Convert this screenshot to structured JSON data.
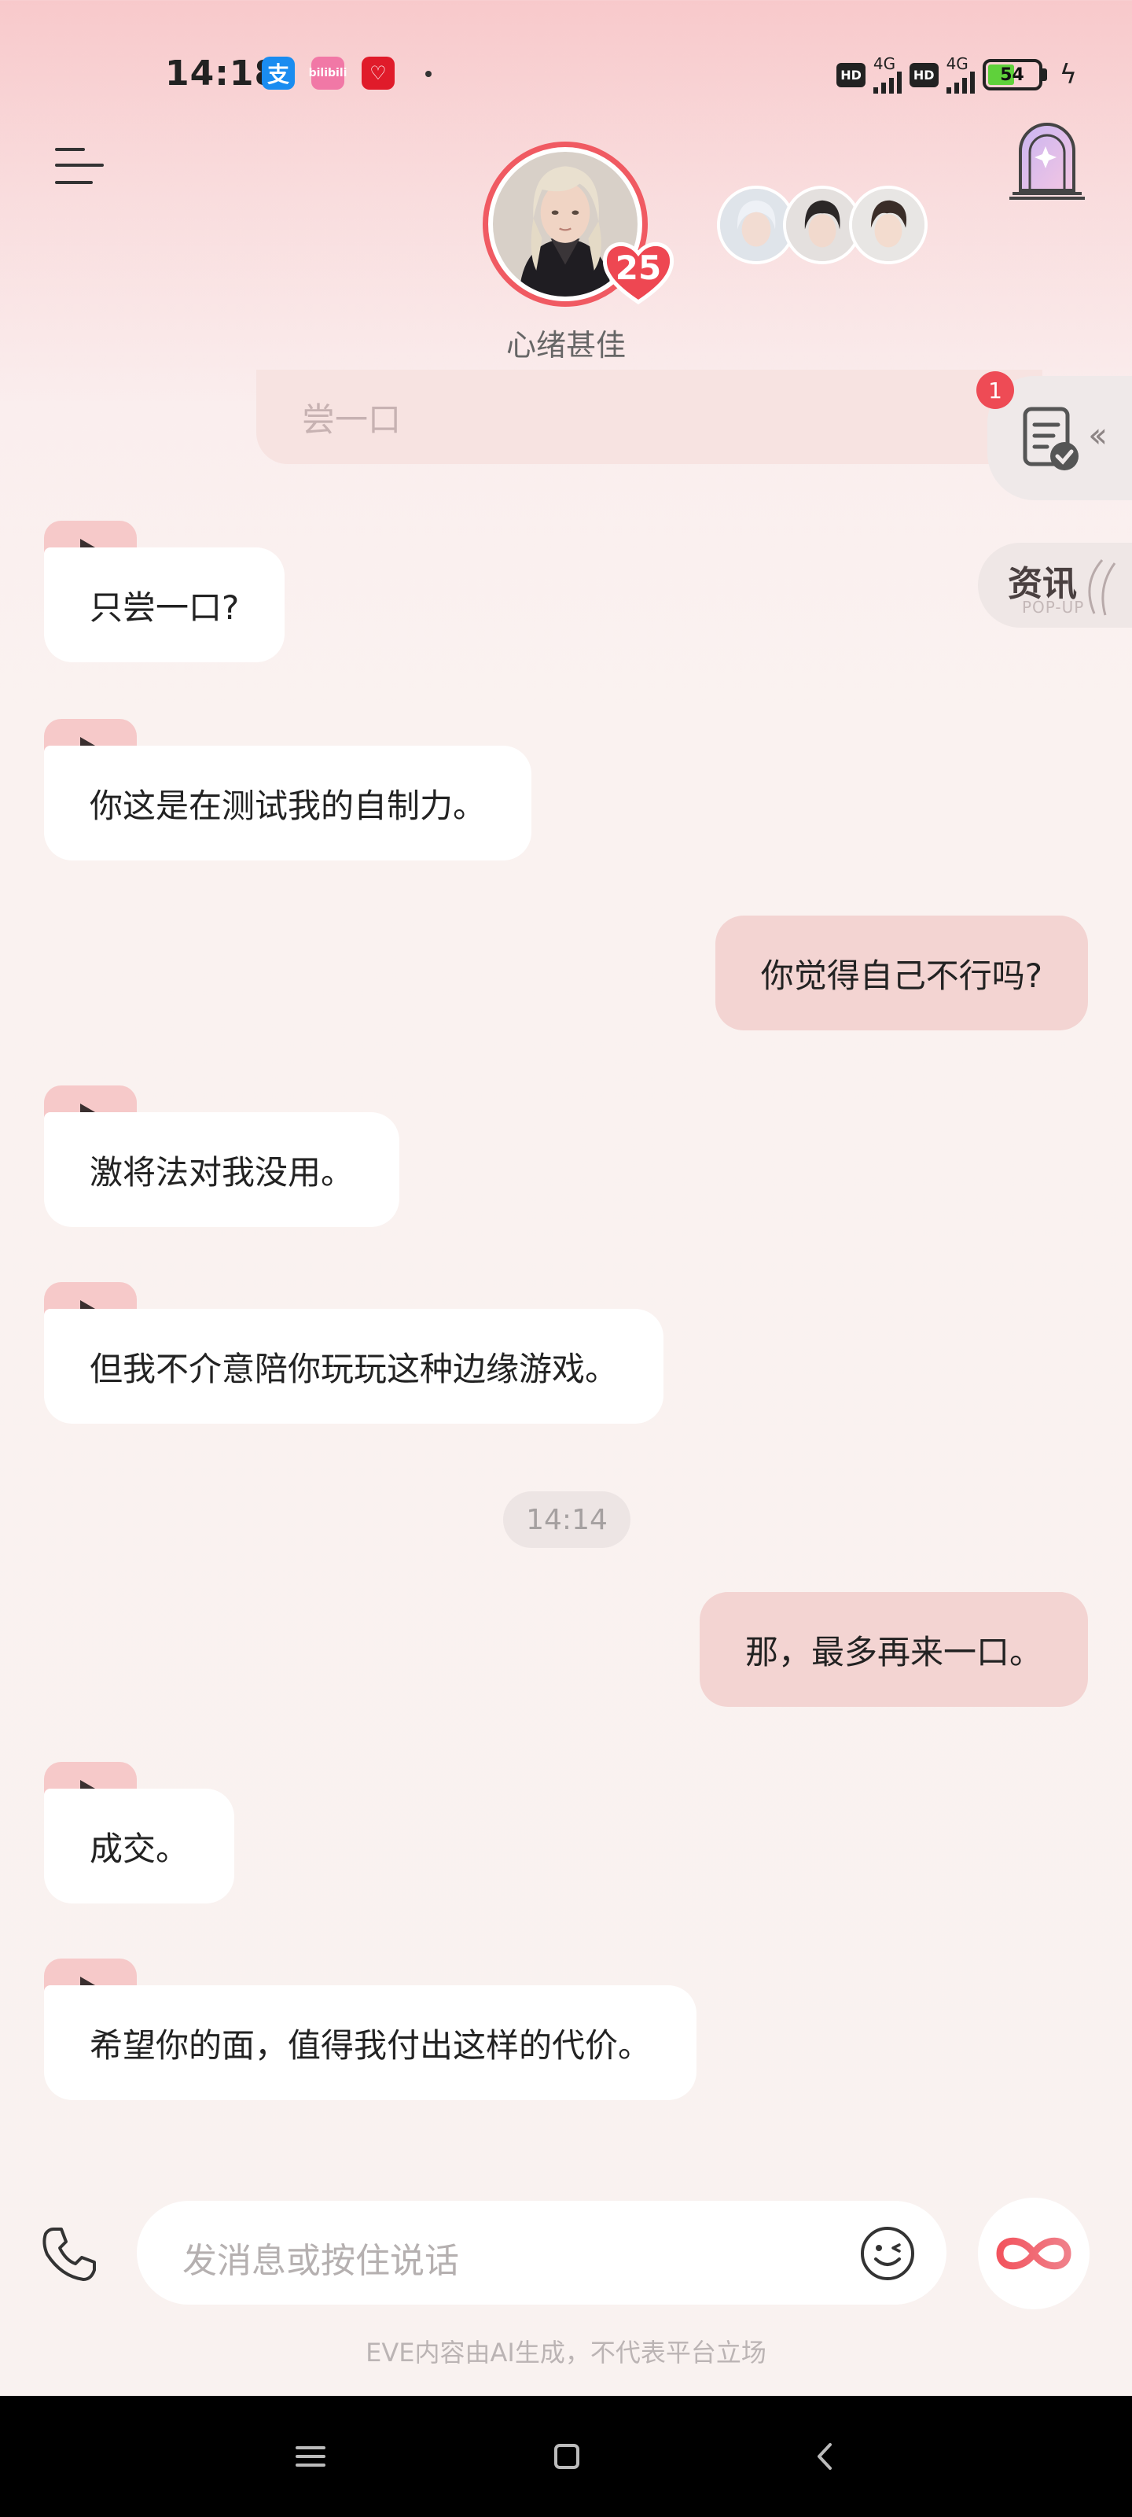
{
  "status_bar": {
    "time": "14:18",
    "apps": [
      {
        "name": "alipay-icon",
        "glyph": "支"
      },
      {
        "name": "bilibili-icon",
        "glyph": "bilibili"
      },
      {
        "name": "heart-app-icon",
        "glyph": "♡"
      }
    ],
    "hd_label": "HD",
    "network_label": "4G",
    "battery_level": "54"
  },
  "header": {
    "level": "25",
    "mood": "心绪甚佳"
  },
  "side_widgets": {
    "task_badge_count": "1",
    "news_title": "资讯",
    "news_subtitle": "POP-UP"
  },
  "chat": {
    "partial_message": "尝一口",
    "messages": [
      {
        "side": "in",
        "text": "只尝一口?"
      },
      {
        "side": "in",
        "text": "你这是在测试我的自制力。"
      },
      {
        "side": "out",
        "text": "你觉得自己不行吗?"
      },
      {
        "side": "in",
        "text": "激将法对我没用。"
      },
      {
        "side": "in",
        "text": "但我不介意陪你玩玩这种边缘游戏。"
      },
      {
        "side": "out",
        "text": "那，最多再来一口。"
      },
      {
        "side": "in",
        "text": "成交。"
      },
      {
        "side": "in",
        "text": "希望你的面，值得我付出这样的代价。"
      }
    ],
    "time_separator": "14:14"
  },
  "input": {
    "placeholder": "发消息或按住说话"
  },
  "disclaimer": "EVE内容由AI生成，不代表平台立场",
  "colors": {
    "accent": "#f05a62",
    "bubble_out": "#f3d4d2",
    "bubble_in": "#ffffff",
    "play_badge": "#f6c9c9"
  }
}
